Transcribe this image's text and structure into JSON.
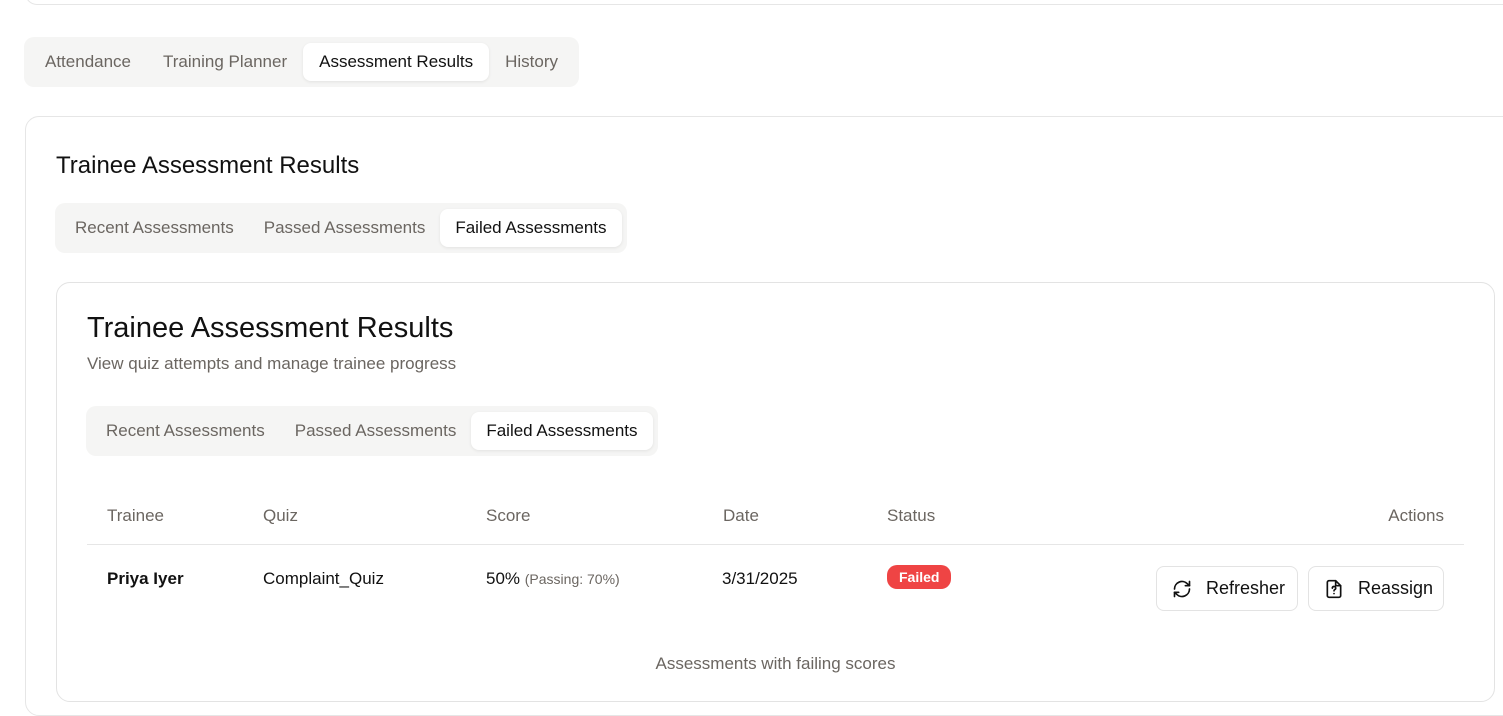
{
  "main_tabs": [
    "Attendance",
    "Training Planner",
    "Assessment Results",
    "History"
  ],
  "section": {
    "title": "Trainee Assessment Results",
    "tabs": [
      "Recent Assessments",
      "Passed Assessments",
      "Failed Assessments"
    ]
  },
  "card": {
    "title": "Trainee Assessment Results",
    "subtitle": "View quiz attempts and manage trainee progress",
    "tabs": [
      "Recent Assessments",
      "Passed Assessments",
      "Failed Assessments"
    ]
  },
  "table": {
    "headers": [
      "Trainee",
      "Quiz",
      "Score",
      "Date",
      "Status",
      "Actions"
    ],
    "rows": [
      {
        "trainee": "Priya Iyer",
        "quiz": "Complaint_Quiz",
        "score": "50%",
        "passing": "(Passing: 70%)",
        "date": "3/31/2025",
        "status": "Failed",
        "actions": [
          "Refresher",
          "Reassign"
        ]
      }
    ],
    "caption": "Assessments with failing scores"
  },
  "colors": {
    "failed_badge": "#ef4444",
    "muted_text": "#6b6661",
    "tab_track": "#f5f5f4"
  }
}
